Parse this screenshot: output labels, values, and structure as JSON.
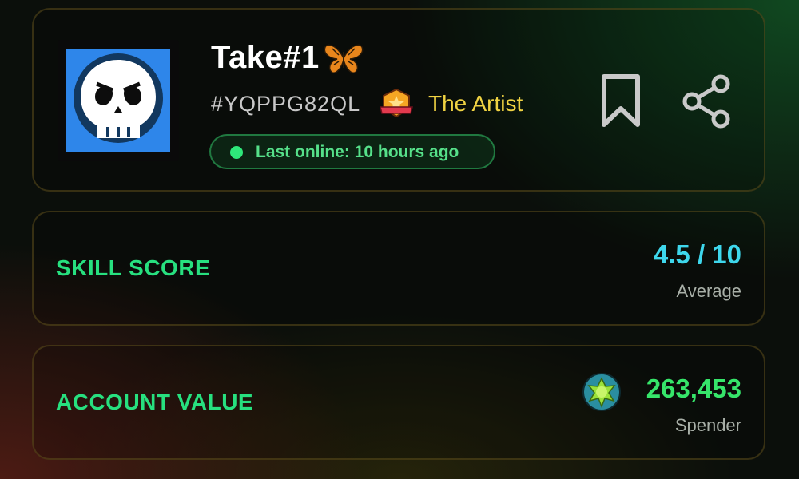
{
  "profile": {
    "name": "Take#1",
    "name_emoji": "butterfly",
    "tag": "#YQPPG82QL",
    "title": "The Artist",
    "last_online": "Last online: 10 hours ago",
    "avatar_icon": "skull-icon",
    "actions": [
      "bookmark-icon",
      "share-icon"
    ]
  },
  "skill": {
    "label": "SKILL SCORE",
    "value": "4.5 / 10",
    "rating": "Average"
  },
  "account_value": {
    "label": "ACCOUNT VALUE",
    "value": "263,453",
    "tier": "Spender",
    "icon": "gem-icon"
  },
  "colors": {
    "accent_green": "#27e07f",
    "skill_cyan": "#3ed7ec",
    "title_gold": "#f0d343",
    "avatar_blue": "#2e86ea"
  }
}
